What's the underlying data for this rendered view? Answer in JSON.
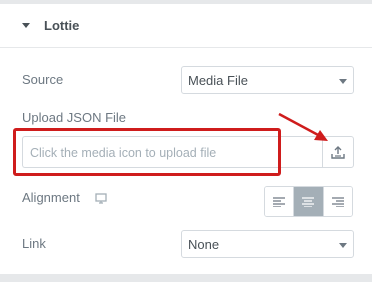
{
  "section": {
    "title": "Lottie"
  },
  "source": {
    "label": "Source",
    "value": "Media File"
  },
  "upload": {
    "label": "Upload JSON File",
    "placeholder": "Click the media icon to upload file",
    "button_icon": "upload-icon"
  },
  "alignment": {
    "label": "Alignment",
    "device_icon": "desktop-icon",
    "options": [
      "left",
      "center",
      "right"
    ],
    "selected": "center"
  },
  "link": {
    "label": "Link",
    "value": "None"
  },
  "annotation": {
    "color": "#cf1c1c"
  }
}
